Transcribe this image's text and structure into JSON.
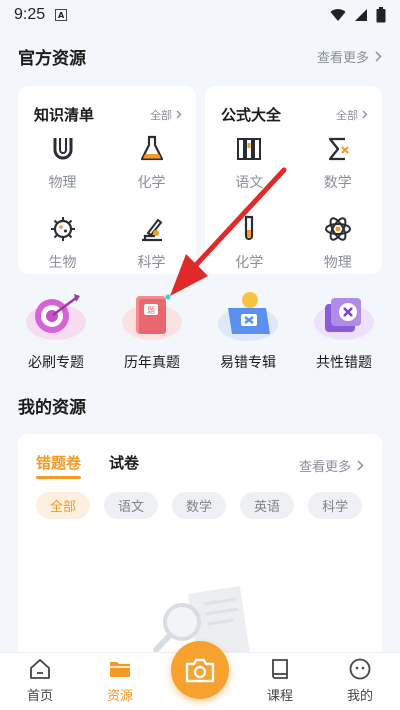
{
  "status": {
    "time": "9:25",
    "notif_glyph": "A"
  },
  "official": {
    "title": "官方资源",
    "more": "查看更多",
    "knowledge": {
      "title": "知识清单",
      "all": "全部",
      "items": [
        {
          "label": "物理",
          "icon": "magnet-icon"
        },
        {
          "label": "化学",
          "icon": "flask-icon"
        },
        {
          "label": "生物",
          "icon": "virus-icon"
        },
        {
          "label": "科学",
          "icon": "microscope-icon"
        }
      ]
    },
    "formula": {
      "title": "公式大全",
      "all": "全部",
      "items": [
        {
          "label": "语文",
          "icon": "books-icon"
        },
        {
          "label": "数学",
          "icon": "sigma-icon"
        },
        {
          "label": "化学",
          "icon": "test-tube-icon"
        },
        {
          "label": "物理",
          "icon": "atom-icon"
        }
      ]
    }
  },
  "features": [
    {
      "label": "必刷专题",
      "icon": "target-icon"
    },
    {
      "label": "历年真题",
      "icon": "question-book-icon",
      "badge": "题"
    },
    {
      "label": "易错专辑",
      "icon": "wrong-album-icon"
    },
    {
      "label": "共性错题",
      "icon": "common-wrong-icon"
    }
  ],
  "mine": {
    "title": "我的资源",
    "tabs": [
      {
        "label": "错题卷"
      },
      {
        "label": "试卷"
      }
    ],
    "more": "查看更多",
    "chips": [
      "全部",
      "语文",
      "数学",
      "英语",
      "科学"
    ]
  },
  "tabbar": [
    {
      "label": "首页",
      "icon": "home-icon"
    },
    {
      "label": "资源",
      "icon": "folder-icon"
    },
    {
      "label": "课程",
      "icon": "book-icon"
    },
    {
      "label": "我的",
      "icon": "face-icon"
    }
  ],
  "colors": {
    "accent": "#f59a23",
    "arrow": "#e02a2a",
    "icon_dark": "#2a2d33"
  }
}
